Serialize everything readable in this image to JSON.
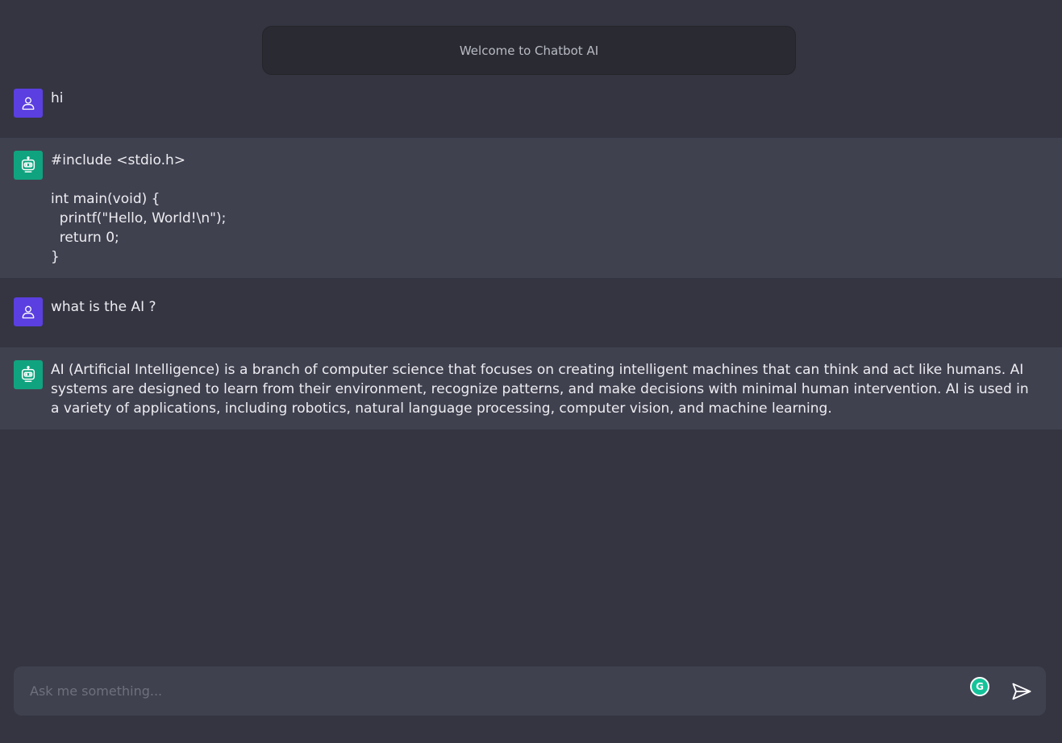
{
  "header": {
    "welcome_text": "Welcome to Chatbot AI"
  },
  "messages": [
    {
      "role": "user",
      "avatar_icon": "user-icon",
      "text": "hi"
    },
    {
      "role": "bot",
      "avatar_icon": "robot-icon",
      "text": "#include <stdio.h>\n\nint main(void) {\n  printf(\"Hello, World!\\n\");\n  return 0;\n}"
    },
    {
      "role": "user",
      "avatar_icon": "user-icon",
      "text": "what is the AI ?"
    },
    {
      "role": "bot",
      "avatar_icon": "robot-icon",
      "text": "AI (Artificial Intelligence) is a branch of computer science that focuses on creating intelligent machines that can think and act like humans. AI systems are designed to learn from their environment, recognize patterns, and make decisions with minimal human intervention. AI is used in a variety of applications, including robotics, natural language processing, computer vision, and machine learning."
    }
  ],
  "input": {
    "placeholder": "Ask me something...",
    "value": ""
  },
  "icons": {
    "grammarly": "grammarly-icon",
    "send": "send-icon"
  },
  "colors": {
    "background": "#343541",
    "bot_row": "#40414f",
    "user_avatar": "#5b3fe0",
    "bot_avatar": "#10a37f",
    "grammarly": "#15c39a"
  }
}
